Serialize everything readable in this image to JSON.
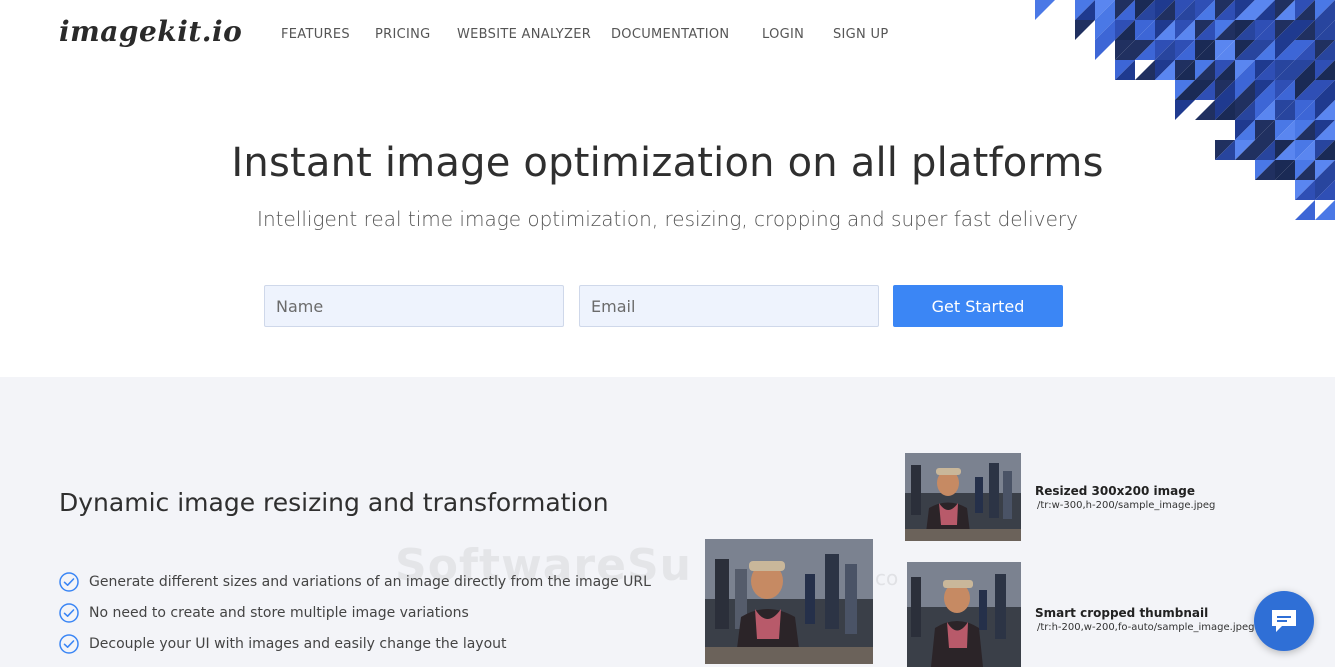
{
  "brand": {
    "logo": "imagekit.io"
  },
  "nav": [
    "FEATURES",
    "PRICING",
    "WEBSITE ANALYZER",
    "DOCUMENTATION",
    "LOGIN",
    "SIGN UP"
  ],
  "hero": {
    "title": "Instant image optimization on all platforms",
    "subtitle": "Intelligent real time image optimization, resizing, cropping and super fast delivery",
    "name_placeholder": "Name",
    "email_placeholder": "Email",
    "cta": "Get Started"
  },
  "section": {
    "title": "Dynamic image resizing and transformation",
    "features": [
      "Generate different sizes and variations of an image directly from the image URL",
      "No need to create and store multiple image variations",
      "Decouple your UI with images and easily change the layout"
    ],
    "examples": [
      {
        "title": "Resized 300x200 image",
        "url": "/tr:w-300,h-200/sample_image.jpeg"
      },
      {
        "title": "Smart cropped thumbnail",
        "url": "/tr:h-200,w-200,fo-auto/sample_image.jpeg"
      }
    ]
  },
  "watermark": {
    "text": "SoftwareSu",
    "suffix": "co"
  },
  "colors": {
    "accent": "#3b86f5",
    "deco_blue": "#2f4fb5",
    "section_bg": "#f3f4f8"
  },
  "icons": {
    "feature": "check-circle-icon",
    "chat": "chat-bubble-icon"
  }
}
